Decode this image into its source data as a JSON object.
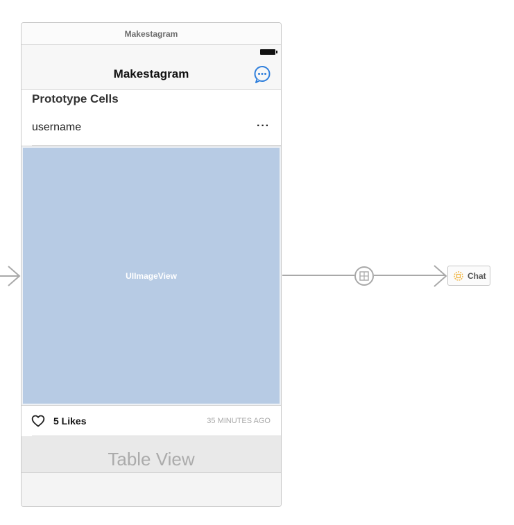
{
  "scene": {
    "title_bar": "Makestagram",
    "nav_title": "Makestagram",
    "prototype_cells_label": "Prototype Cells"
  },
  "header_cell": {
    "username": "username",
    "more_label": "···"
  },
  "image_cell": {
    "placeholder": "UIImageView"
  },
  "action_cell": {
    "likes": "5 Likes",
    "time": "35 MINUTES AGO"
  },
  "table": {
    "label": "Table View"
  },
  "destination_scene": {
    "label": "Chat"
  },
  "icons": {
    "nav_right": "chat-bubble-icon",
    "like": "heart-icon",
    "segue": "segue-icon",
    "view_controller": "view-controller-icon"
  },
  "colors": {
    "accent": "#2f7fdc",
    "image_placeholder": "#b7cbe4",
    "segue": "#a9a9a9"
  }
}
